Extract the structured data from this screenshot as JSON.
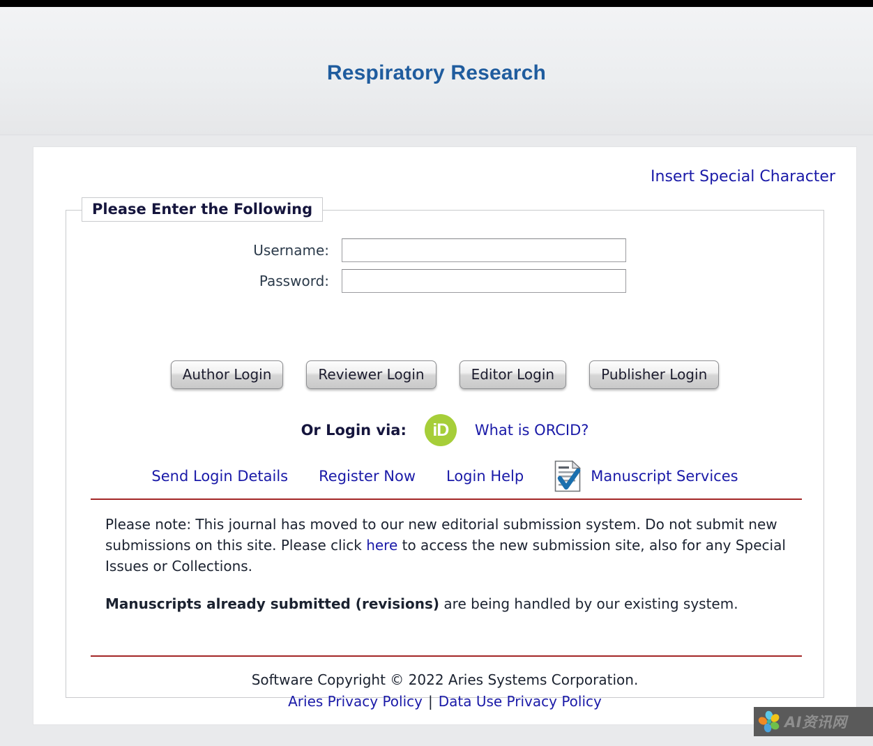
{
  "header": {
    "journal_title": "Respiratory Research",
    "title_color": "#1f5c9e"
  },
  "toolbar": {
    "insert_special_character": "Insert Special Character"
  },
  "login_form": {
    "legend": "Please Enter the Following",
    "username_label": "Username:",
    "username_value": "",
    "username_placeholder": "",
    "password_label": "Password:",
    "password_value": "",
    "password_placeholder": "",
    "buttons": [
      {
        "label": "Author Login",
        "name": "author-login-button"
      },
      {
        "label": "Reviewer Login",
        "name": "reviewer-login-button"
      },
      {
        "label": "Editor Login",
        "name": "editor-login-button"
      },
      {
        "label": "Publisher Login",
        "name": "publisher-login-button"
      }
    ]
  },
  "orcid": {
    "prompt": "Or Login via:",
    "icon_label": "iD",
    "icon_color": "#a6ce39",
    "what_is_link": "What is ORCID?"
  },
  "links": {
    "send_login_details": "Send Login Details",
    "register_now": "Register Now",
    "login_help": "Login Help",
    "manuscript_services": "Manuscript Services"
  },
  "notes": {
    "paragraph1_part1": "Please note: This journal has moved to our new editorial submission system. Do not submit new submissions on this site. Please click ",
    "paragraph1_link": "here",
    "paragraph1_part2": " to access the new submission site, also for any Special Issues or Collections.",
    "paragraph2_bold": "Manuscripts already submitted (revisions)",
    "paragraph2_rest": " are being handled by our existing system.",
    "divider_color": "#a32626"
  },
  "footer": {
    "copyright": "Software Copyright © 2022 Aries Systems Corporation.",
    "aries_privacy_policy": "Aries Privacy Policy",
    "separator": "|",
    "data_use_privacy_policy": "Data Use Privacy Policy"
  },
  "watermark": {
    "text": "AI资讯网"
  }
}
